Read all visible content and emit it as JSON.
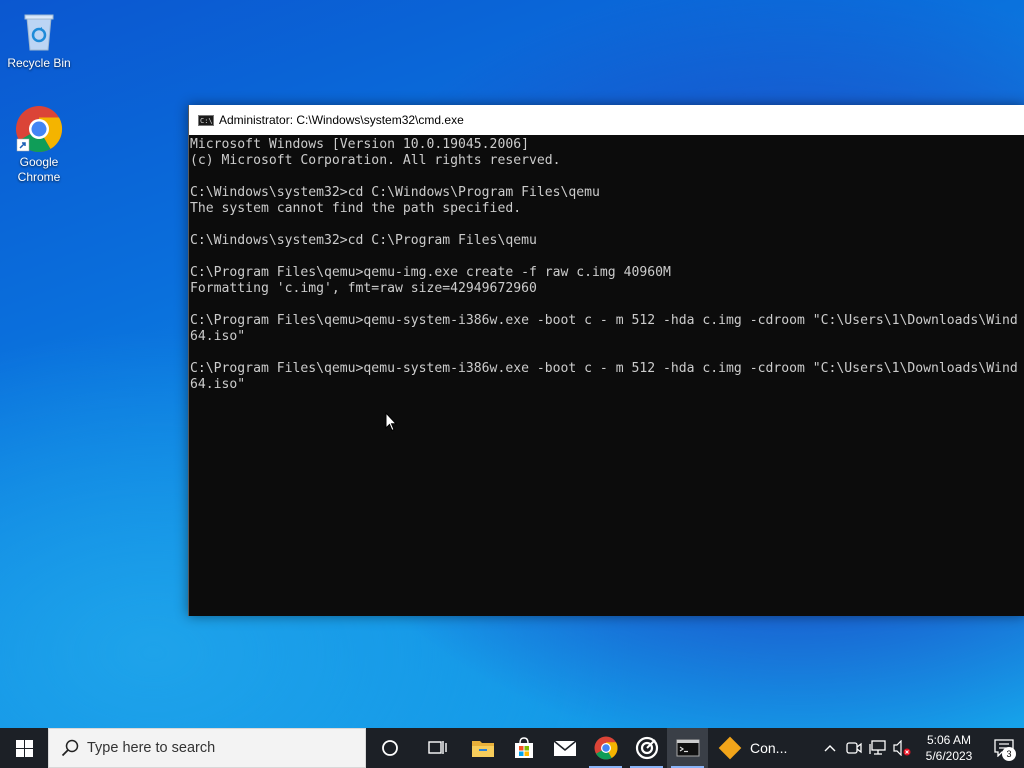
{
  "desktop": {
    "icons": [
      {
        "label": "Recycle Bin",
        "icon": "recycle-bin-icon"
      },
      {
        "label": "Google Chrome",
        "icon": "chrome-icon"
      }
    ]
  },
  "cmd": {
    "title": "Administrator: C:\\Windows\\system32\\cmd.exe",
    "lines": [
      "Microsoft Windows [Version 10.0.19045.2006]",
      "(c) Microsoft Corporation. All rights reserved.",
      "",
      "C:\\Windows\\system32>cd C:\\Windows\\Program Files\\qemu",
      "The system cannot find the path specified.",
      "",
      "C:\\Windows\\system32>cd C:\\Program Files\\qemu",
      "",
      "C:\\Program Files\\qemu>qemu-img.exe create -f raw c.img 40960M",
      "Formatting 'c.img', fmt=raw size=42949672960",
      "",
      "C:\\Program Files\\qemu>qemu-system-i386w.exe -boot c - m 512 -hda c.img -cdroom \"C:\\Users\\1\\Downloads\\Wind",
      "64.iso\"",
      "",
      "C:\\Program Files\\qemu>qemu-system-i386w.exe -boot c - m 512 -hda c.img -cdroom \"C:\\Users\\1\\Downloads\\Wind",
      "64.iso\""
    ]
  },
  "taskbar": {
    "search_placeholder": "Type here to search",
    "apps": [
      "cortana-icon",
      "task-view-icon",
      "file-explorer-icon",
      "microsoft-store-icon",
      "mail-icon",
      "chrome-icon",
      "app-ring-icon",
      "cmd-icon"
    ],
    "con_label": "Con...",
    "clock": {
      "time": "5:06 AM",
      "date": "5/6/2023"
    },
    "notification_count": "3"
  },
  "colors": {
    "cmd_bg": "#0c0c0c",
    "cmd_text": "#cccccc",
    "taskbar_bg": "#1c2026"
  }
}
